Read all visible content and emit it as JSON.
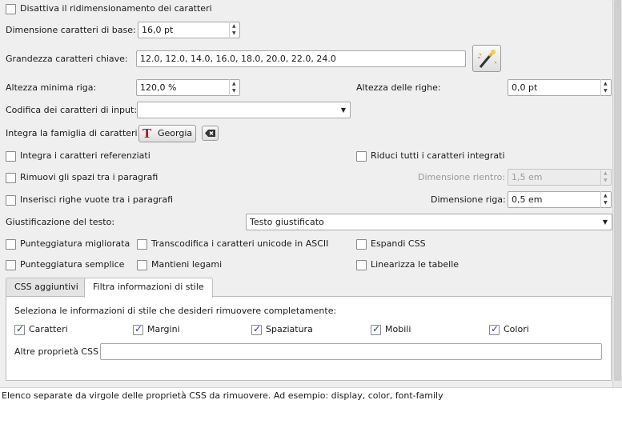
{
  "options": {
    "disable_resize": "Disattiva il ridimensionamento dei caratteri",
    "base_font_label": "Dimensione caratteri di base:",
    "base_font_value": "16,0 pt",
    "key_sizes_label": "Grandezza caratteri chiave:",
    "key_sizes_value": "12.0, 12.0, 14.0, 16.0, 18.0, 20.0, 22.0, 24.0",
    "min_row_label": "Altezza minima riga:",
    "min_row_value": "120,0 %",
    "row_height_label": "Altezza delle righe:",
    "row_height_value": "0,0 pt",
    "input_encoding_label": "Codifica dei caratteri di input:",
    "input_encoding_value": "",
    "embed_family_label": "Integra la famiglia di caratteri:",
    "embed_family_value": "Georgia",
    "embed_referenced": "Integra i caratteri referenziati",
    "subset_all": "Riduci tutti i caratteri integrati",
    "remove_spacing": "Rimuovi gli spazi tra i paragrafi",
    "indent_size_label": "Dimensione rientro:",
    "indent_size_value": "1,5 em",
    "insert_blank": "Inserisci righe vuote tra i paragrafi",
    "line_size_label": "Dimensione riga:",
    "line_size_value": "0,5 em",
    "justification_label": "Giustificazione del testo:",
    "justification_value": "Testo giustificato",
    "smarten_punct": "Punteggiatura migliorata",
    "transliterate": "Transcodifica i caratteri unicode in ASCII",
    "expand_css": "Espandi CSS",
    "unsmarten_punct": "Punteggiatura semplice",
    "keep_ligatures": "Mantieni legami",
    "linearize_tables": "Linearizza le tabelle"
  },
  "tabs": [
    {
      "label": "CSS aggiuntivi"
    },
    {
      "label": "Filtra informazioni di stile"
    }
  ],
  "filter": {
    "heading": "Seleziona le informazioni di stile che desideri rimuovere completamente:",
    "checks": [
      {
        "label": "Caratteri"
      },
      {
        "label": "Margini"
      },
      {
        "label": "Spaziatura"
      },
      {
        "label": "Mobili"
      },
      {
        "label": "Colori"
      }
    ],
    "other_label": "Altre proprietà CSS",
    "other_value": ""
  },
  "status": {
    "text": "Elenco separate da virgole delle proprietà CSS da rimuovere. Ad esempio: display, color, font-family"
  },
  "colors": {
    "panel": "#efefef",
    "check": "#2a3f8f",
    "font_icon_red": "#b02020"
  }
}
